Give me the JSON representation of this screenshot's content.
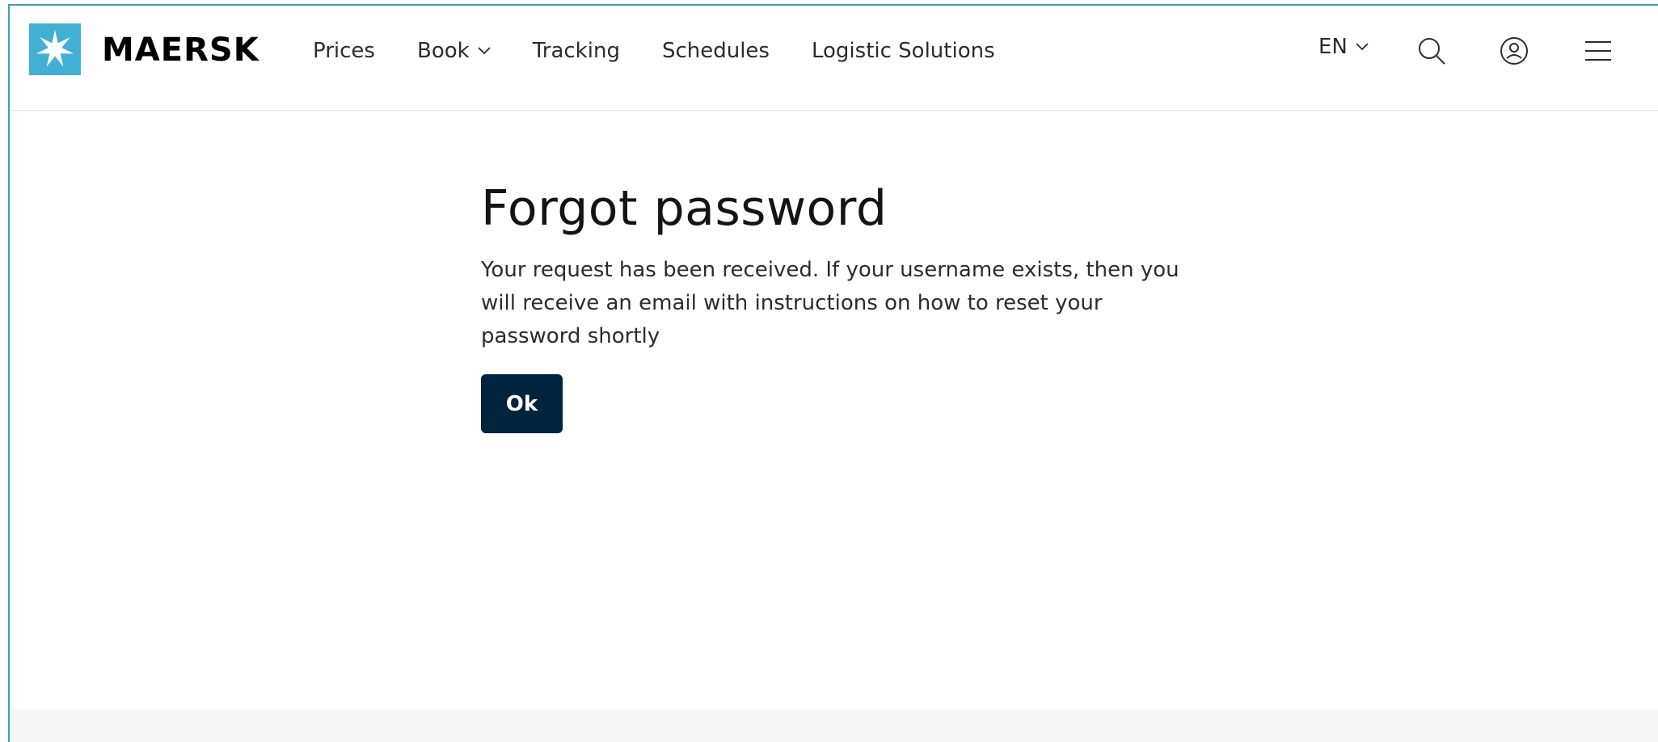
{
  "brand": {
    "name": "MAERSK",
    "logo_icon": "star-icon",
    "logo_color": "#42b0d5"
  },
  "nav": {
    "items": [
      {
        "label": "Prices",
        "has_dropdown": false
      },
      {
        "label": "Book",
        "has_dropdown": true
      },
      {
        "label": "Tracking",
        "has_dropdown": false
      },
      {
        "label": "Schedules",
        "has_dropdown": false
      },
      {
        "label": "Logistic Solutions",
        "has_dropdown": false
      }
    ]
  },
  "tools": {
    "language": "EN",
    "search_icon": "search-icon",
    "account_icon": "user-circle-icon",
    "menu_icon": "hamburger-menu-icon"
  },
  "main": {
    "title": "Forgot password",
    "message": "Your request has been received. If your username exists, then you will receive an email with instructions on how to reset your password shortly",
    "ok_label": "Ok"
  },
  "colors": {
    "button_bg": "#00243d",
    "frame_border": "#42a0a6",
    "footer_bg": "#f7f7f7"
  }
}
